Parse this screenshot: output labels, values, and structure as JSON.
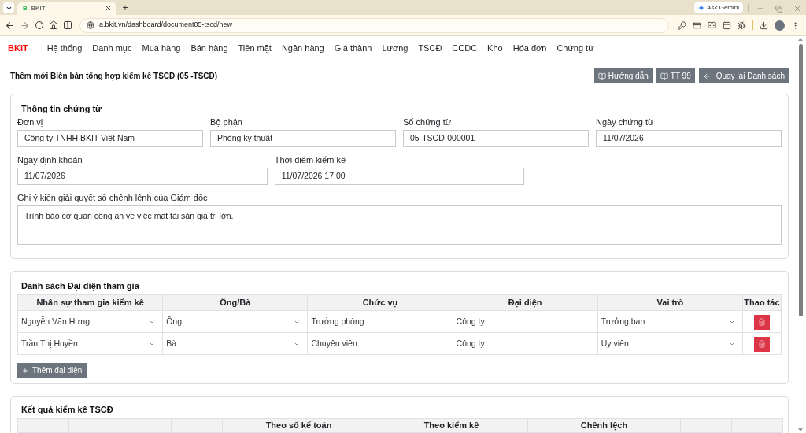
{
  "browser": {
    "tabs": [
      {
        "favicon": "B",
        "title": "BKIT",
        "selected": true
      }
    ],
    "new_tab": "+",
    "gemini_button": "Ask Gemini",
    "url": "a.bkit.vn/dashboard/document05-tscd/new"
  },
  "nav": {
    "brand": "BKIT",
    "items": [
      "Hệ thống",
      "Danh mục",
      "Mua hàng",
      "Bán hàng",
      "Tiền mặt",
      "Ngân hàng",
      "Giá thành",
      "Lương",
      "TSCĐ",
      "CCDC",
      "Kho",
      "Hóa đơn",
      "Chứng từ"
    ]
  },
  "header": {
    "title": "Thêm mới Biên bản tổng hợp kiểm kê TSCĐ (05 -TSCĐ)",
    "buttons": [
      {
        "kind": "reference",
        "label": "Hướng dẫn"
      },
      {
        "kind": "reference",
        "label": "TT 99"
      },
      {
        "kind": "return",
        "label": "Quay lại Danh sách"
      }
    ]
  },
  "document_info": {
    "title": "Thông tin chứng từ",
    "rows": [
      [
        {
          "label": "Đơn vị",
          "value": "Công ty TNHH BKIT Việt Nam"
        },
        {
          "label": "Bộ phận",
          "value": "Phòng kỹ thuật"
        },
        {
          "label": "Số chứng từ",
          "value": "05-TSCD-000001"
        },
        {
          "label": "Ngày chứng từ",
          "value": "11/07/2026"
        }
      ],
      [
        {
          "label": "Ngày định khoản",
          "value": "11/07/2026"
        },
        {
          "label": "Thời điểm kiểm kê",
          "value": "11/07/2026 17:00"
        }
      ]
    ],
    "note": {
      "label": "Ghi ý kiến giải quyết số chênh lệnh của Giám đốc",
      "value": "Trình báo cơ quan công an về việc mất tài sản giá trị lớn."
    }
  },
  "participants": {
    "title": "Danh sách Đại diện tham gia",
    "columns": [
      {
        "label": "Nhân sự tham gia kiểm kê",
        "kind": "select"
      },
      {
        "label": "Ông/Bà",
        "kind": "select"
      },
      {
        "label": "Chức vụ",
        "kind": "text"
      },
      {
        "label": "Đại diện",
        "kind": "text"
      },
      {
        "label": "Vai trò",
        "kind": "select"
      },
      {
        "label": "Thao tác",
        "kind": "action"
      }
    ],
    "rows": [
      [
        "Nguyễn Văn Hưng",
        "Ông",
        "Trưởng phòng",
        "Công ty",
        "Trưởng ban"
      ],
      [
        "Trần Thị Huyền",
        "Bà",
        "Chuyên viên",
        "Công ty",
        "Ủy viên"
      ]
    ],
    "add_button": "Thêm đại diện"
  },
  "results": {
    "title": "Kết quả kiểm kê TSCĐ",
    "header_cells": [
      {
        "kind": "empty"
      },
      {
        "kind": "empty"
      },
      {
        "kind": "empty"
      },
      {
        "kind": "empty"
      },
      {
        "kind": "group",
        "label": "Theo sổ kế toán"
      },
      {
        "kind": "group",
        "label": "Theo kiểm kê"
      },
      {
        "kind": "group",
        "label": "Chênh lệch"
      },
      {
        "kind": "empty"
      },
      {
        "kind": "empty"
      }
    ]
  }
}
